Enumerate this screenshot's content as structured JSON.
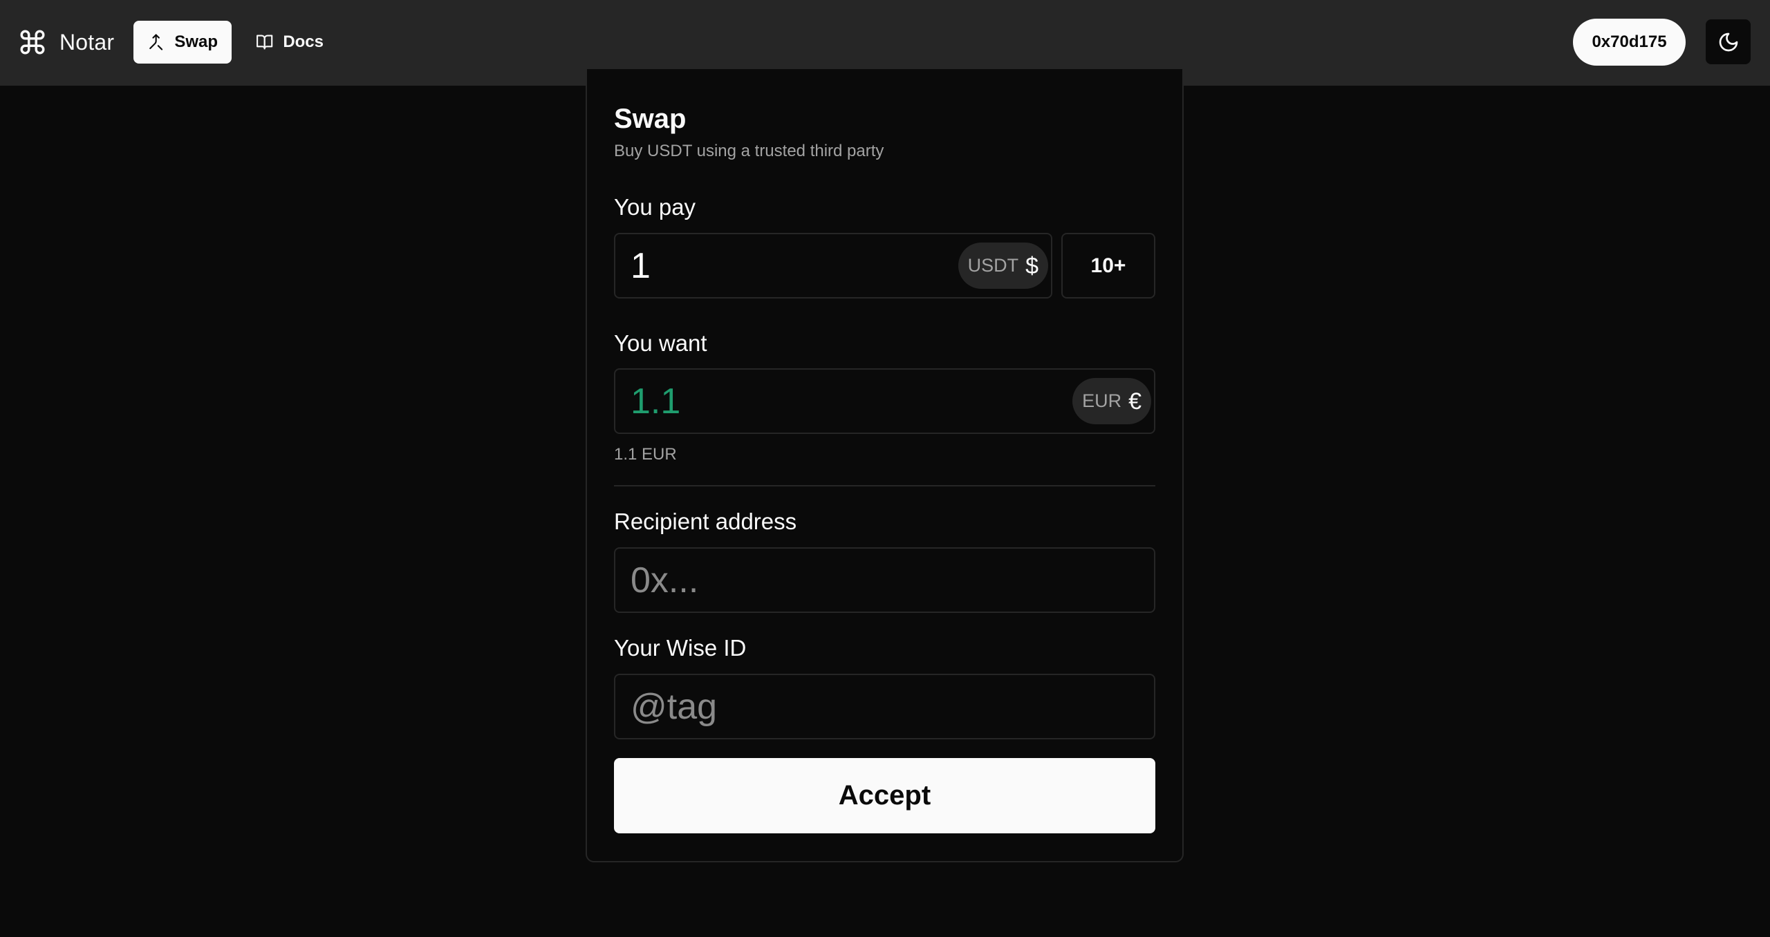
{
  "app": {
    "name": "Notar",
    "brand_icon": "command-icon"
  },
  "nav": {
    "items": [
      {
        "label": "Swap",
        "icon": "merge-arrow-icon",
        "active": true
      },
      {
        "label": "Docs",
        "icon": "book-open-icon",
        "active": false
      }
    ]
  },
  "header": {
    "wallet_address": "0x70d175",
    "theme_icon": "moon-icon"
  },
  "swap": {
    "title": "Swap",
    "subtitle": "Buy USDT using a trusted third party",
    "pay": {
      "label": "You pay",
      "value": "1",
      "token": "USDT",
      "token_symbol": "$",
      "max_label": "10+"
    },
    "want": {
      "label": "You want",
      "value": "1.1",
      "token": "EUR",
      "token_symbol": "€",
      "hint": "1.1 EUR"
    },
    "recipient": {
      "label": "Recipient address",
      "placeholder": "0x..."
    },
    "wise": {
      "label": "Your Wise ID",
      "placeholder": "@tag"
    },
    "accept_label": "Accept"
  },
  "colors": {
    "background": "#0a0a0a",
    "topbar": "#262626",
    "border": "#262626",
    "foreground": "#fafafa",
    "muted": "#a3a3a3",
    "accent_green": "#1f9d6e"
  }
}
